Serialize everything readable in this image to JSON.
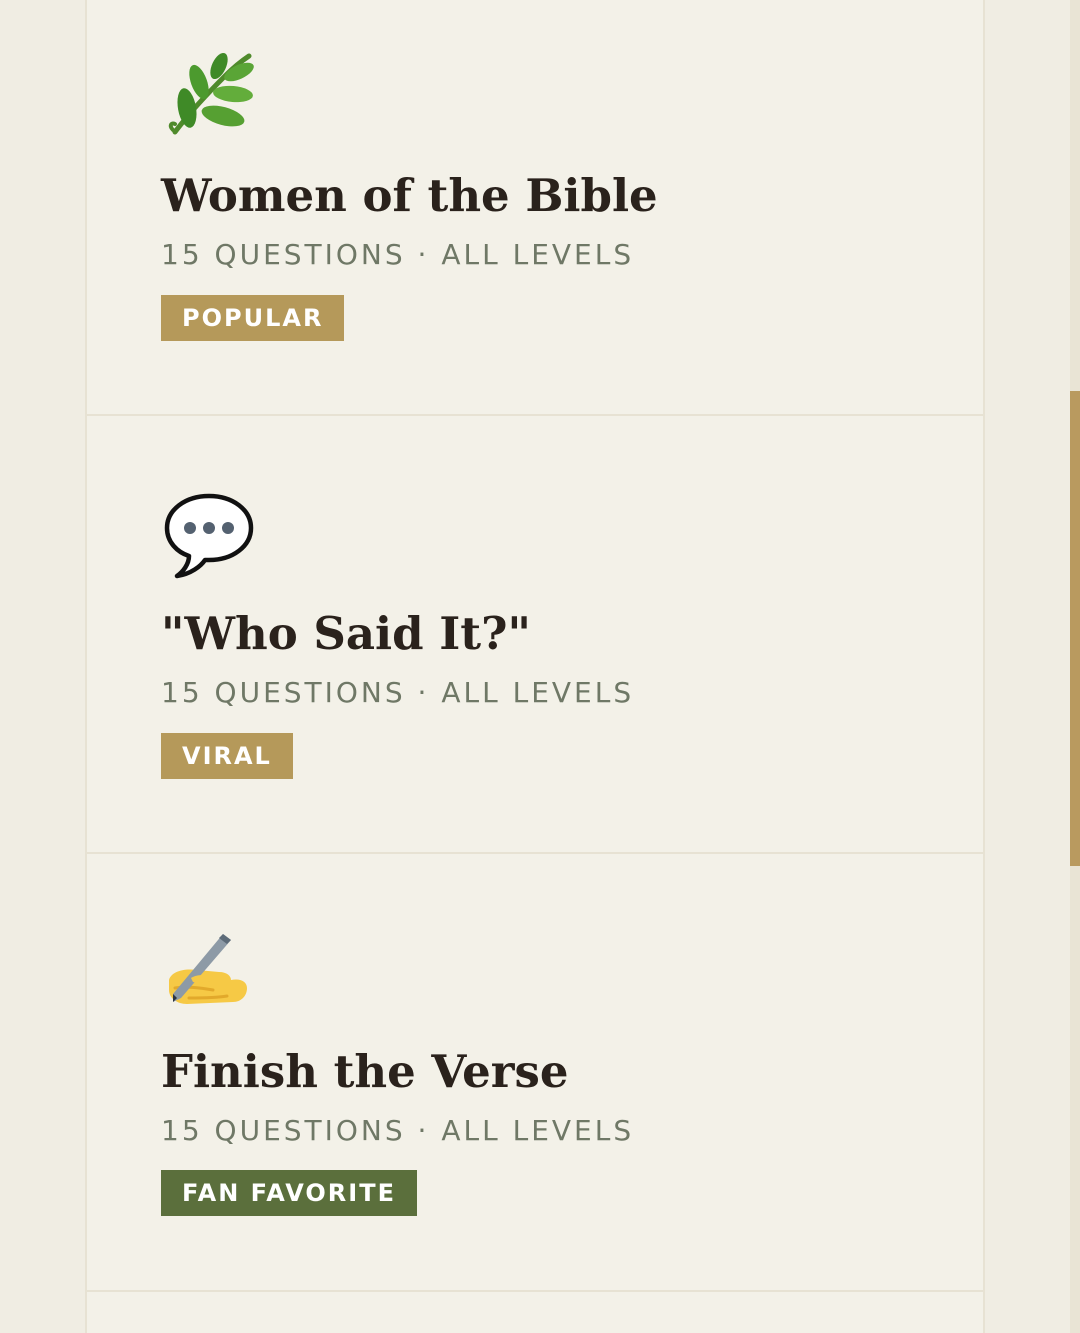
{
  "quizzes": [
    {
      "icon": "herb-icon",
      "title": "Women of the Bible",
      "meta": "15 QUESTIONS · ALL LEVELS",
      "badge": "POPULAR",
      "badge_color": "#b5995a"
    },
    {
      "icon": "speech-balloon-icon",
      "title": "\"Who Said It?\"",
      "meta": "15 QUESTIONS · ALL LEVELS",
      "badge": "VIRAL",
      "badge_color": "#b5995a"
    },
    {
      "icon": "writing-hand-icon",
      "title": "Finish the Verse",
      "meta": "15 QUESTIONS · ALL LEVELS",
      "badge": "FAN FAVORITE",
      "badge_color": "#5b6f3c"
    }
  ],
  "colors": {
    "background": "#f3f1e8",
    "title": "#2a221c",
    "meta": "#6f7866",
    "badge_gold": "#b5995a",
    "badge_green": "#5b6f3c",
    "scrollbar": "#b99a5f"
  }
}
